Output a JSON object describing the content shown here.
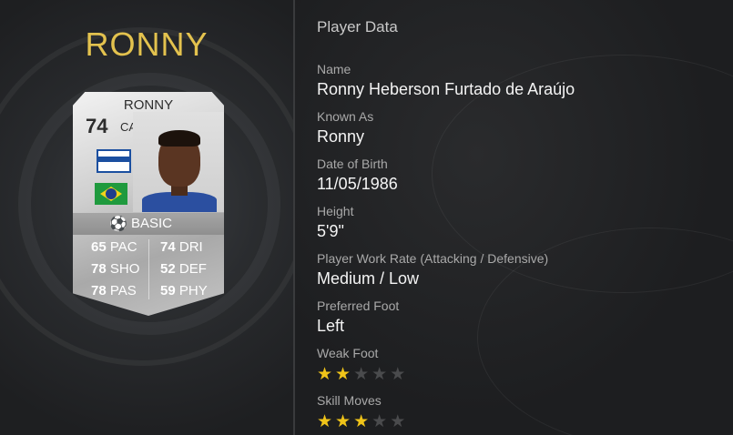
{
  "player": {
    "title_name": "RONNY"
  },
  "card": {
    "name": "RONNY",
    "rating": "74",
    "position": "CAM",
    "type": "BASIC",
    "stats": [
      {
        "value": "65",
        "label": "PAC"
      },
      {
        "value": "74",
        "label": "DRI"
      },
      {
        "value": "78",
        "label": "SHO"
      },
      {
        "value": "52",
        "label": "DEF"
      },
      {
        "value": "78",
        "label": "PAS"
      },
      {
        "value": "59",
        "label": "PHY"
      }
    ]
  },
  "details": {
    "section_title": "Player Data",
    "fields": [
      {
        "label": "Name",
        "value": "Ronny Heberson Furtado de Araújo"
      },
      {
        "label": "Known As",
        "value": "Ronny"
      },
      {
        "label": "Date of Birth",
        "value": "11/05/1986"
      },
      {
        "label": "Height",
        "value": "5'9\""
      },
      {
        "label": "Player Work Rate (Attacking / Defensive)",
        "value": "Medium / Low"
      },
      {
        "label": "Preferred Foot",
        "value": "Left"
      }
    ],
    "weak_foot": {
      "label": "Weak Foot",
      "stars": 2,
      "max": 5
    },
    "skill_moves": {
      "label": "Skill Moves",
      "stars": 3,
      "max": 5
    }
  },
  "colors": {
    "title_gold": "#e3c24e",
    "star_on": "#f0c419",
    "star_off": "#4a4b4d"
  }
}
